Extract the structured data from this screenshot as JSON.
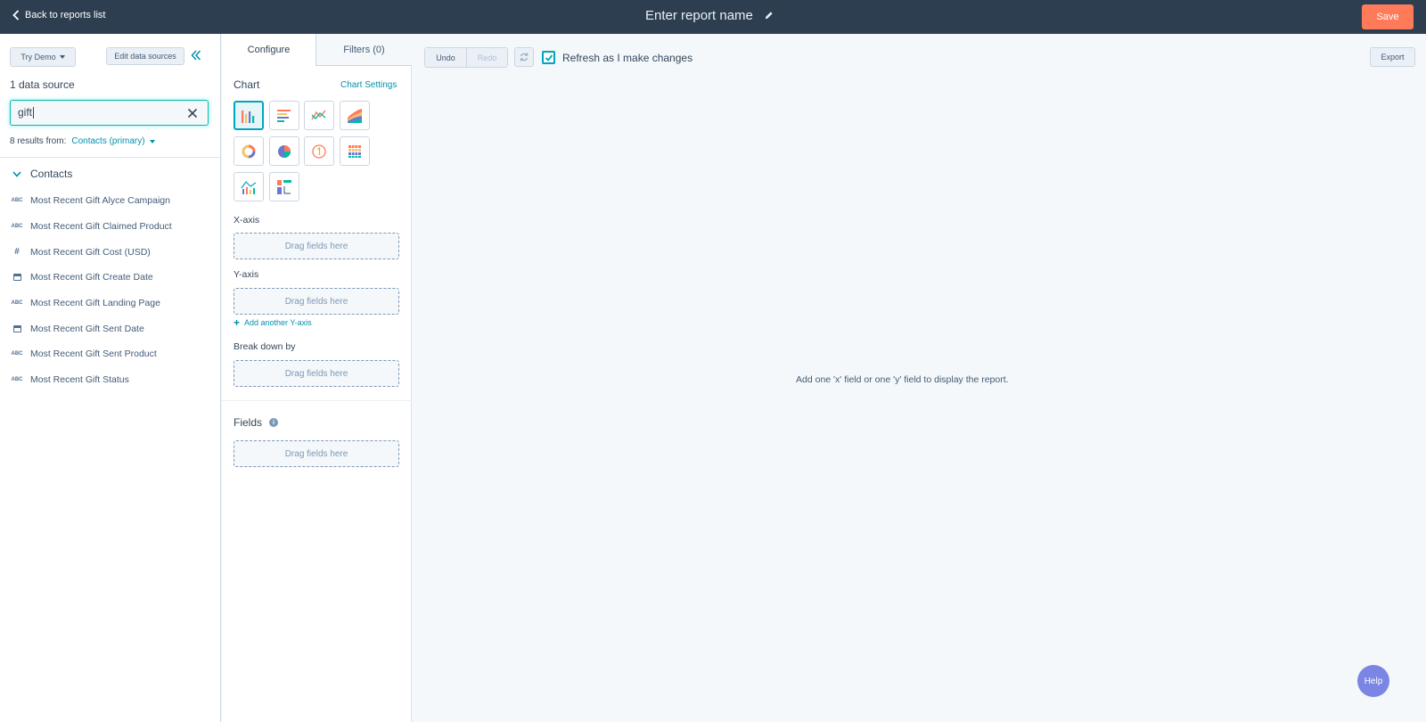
{
  "header": {
    "back_label": "Back to reports list",
    "report_name": "Enter report name",
    "save_label": "Save"
  },
  "sidebar": {
    "try_demo_label": "Try Demo",
    "edit_sources_label": "Edit data sources",
    "data_source_count": "1 data source",
    "search_value": "gift",
    "results_prefix": "8 results from:",
    "results_source": "Contacts (primary)",
    "group_name": "Contacts",
    "fields": [
      {
        "label": "Most Recent Gift Alyce Campaign",
        "type": "ABC"
      },
      {
        "label": "Most Recent Gift Claimed Product",
        "type": "ABC"
      },
      {
        "label": "Most Recent Gift Cost (USD)",
        "type": "#"
      },
      {
        "label": "Most Recent Gift Create Date",
        "type": "calendar"
      },
      {
        "label": "Most Recent Gift Landing Page",
        "type": "ABC"
      },
      {
        "label": "Most Recent Gift Sent Date",
        "type": "calendar"
      },
      {
        "label": "Most Recent Gift Sent Product",
        "type": "ABC"
      },
      {
        "label": "Most Recent Gift Status",
        "type": "ABC"
      }
    ]
  },
  "config": {
    "tabs": {
      "configure": "Configure",
      "filters": "Filters (0)"
    },
    "chart_label": "Chart",
    "chart_settings_label": "Chart Settings",
    "chart_types": [
      "vertical-bar",
      "horizontal-bar",
      "line",
      "area",
      "donut",
      "pie",
      "summary",
      "pivot-table",
      "combination",
      "table"
    ],
    "x_axis_label": "X-axis",
    "y_axis_label": "Y-axis",
    "add_y_label": "Add another Y-axis",
    "breakdown_label": "Break down by",
    "fields_label": "Fields",
    "dropzone_text": "Drag fields here"
  },
  "main": {
    "undo_label": "Undo",
    "redo_label": "Redo",
    "refresh_label": "Refresh as I make changes",
    "refresh_checked": true,
    "export_label": "Export",
    "empty_message": "Add one 'x' field or one 'y' field to display the report.",
    "help_label": "Help"
  },
  "colors": {
    "topbar": "#2d3e50",
    "accent": "#ff7a59",
    "link": "#0091ae",
    "focus": "#00bda5",
    "help": "#7b86e4"
  }
}
